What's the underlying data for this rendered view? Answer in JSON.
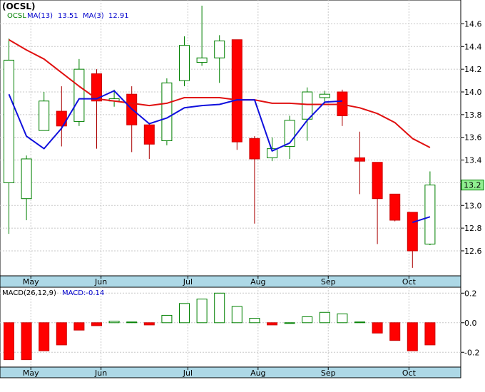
{
  "chart_data": [
    {
      "type": "candlestick",
      "title": "(OCSL)",
      "legend": [
        {
          "label": "OCSL",
          "color": "#008000"
        },
        {
          "label": "MA(13)",
          "color": "#0000cc"
        },
        {
          "label": "13.51",
          "color": "#0000cc"
        },
        {
          "label": "MA(3)",
          "color": "#0000cc"
        },
        {
          "label": "12.91",
          "color": "#0000cc"
        }
      ],
      "ylim": [
        12.38,
        14.81
      ],
      "yticks": [
        12.6,
        12.8,
        13.0,
        13.2,
        13.4,
        13.6,
        13.8,
        14.0,
        14.2,
        14.4,
        14.6
      ],
      "ytick_labels": [
        "12.6",
        "12.8",
        "13.0",
        "13.2",
        "13.4",
        "13.6",
        "13.8",
        "14.0",
        "14.2",
        "14.4",
        "14.6"
      ],
      "months": [
        {
          "label": "May",
          "at": 1.25
        },
        {
          "label": "Jun",
          "at": 5.25
        },
        {
          "label": "Jul",
          "at": 10.2
        },
        {
          "label": "Aug",
          "at": 14.2
        },
        {
          "label": "Sep",
          "at": 18.2
        },
        {
          "label": "Oct",
          "at": 22.8
        }
      ],
      "candles": [
        {
          "o": 13.2,
          "h": 14.47,
          "l": 12.75,
          "c": 14.28
        },
        {
          "o": 13.06,
          "h": 13.44,
          "l": 12.87,
          "c": 13.41
        },
        {
          "o": 13.66,
          "h": 14.0,
          "l": 13.66,
          "c": 13.92
        },
        {
          "o": 13.83,
          "h": 14.05,
          "l": 13.52,
          "c": 13.7
        },
        {
          "o": 13.74,
          "h": 14.29,
          "l": 13.7,
          "c": 14.2
        },
        {
          "o": 14.16,
          "h": 14.2,
          "l": 13.5,
          "c": 13.92
        },
        {
          "o": 13.92,
          "h": 14.02,
          "l": 13.87,
          "c": 13.94
        },
        {
          "o": 13.98,
          "h": 14.05,
          "l": 13.47,
          "c": 13.71
        },
        {
          "o": 13.71,
          "h": 13.73,
          "l": 13.41,
          "c": 13.54
        },
        {
          "o": 13.57,
          "h": 14.12,
          "l": 13.53,
          "c": 14.08
        },
        {
          "o": 14.1,
          "h": 14.49,
          "l": 14.05,
          "c": 14.41
        },
        {
          "o": 14.26,
          "h": 14.76,
          "l": 14.23,
          "c": 14.3
        },
        {
          "o": 14.3,
          "h": 14.5,
          "l": 14.08,
          "c": 14.45
        },
        {
          "o": 14.46,
          "h": 14.46,
          "l": 13.49,
          "c": 13.56
        },
        {
          "o": 13.59,
          "h": 13.61,
          "l": 12.84,
          "c": 13.41
        },
        {
          "o": 13.42,
          "h": 13.6,
          "l": 13.39,
          "c": 13.5
        },
        {
          "o": 13.52,
          "h": 13.79,
          "l": 13.41,
          "c": 13.75
        },
        {
          "o": 13.76,
          "h": 14.04,
          "l": 13.57,
          "c": 14.0
        },
        {
          "o": 13.95,
          "h": 14.01,
          "l": 13.9,
          "c": 13.98
        },
        {
          "o": 14.0,
          "h": 14.02,
          "l": 13.7,
          "c": 13.79
        },
        {
          "o": 13.42,
          "h": 13.65,
          "l": 13.1,
          "c": 13.39
        },
        {
          "o": 13.38,
          "h": 13.38,
          "l": 12.66,
          "c": 13.06
        },
        {
          "o": 13.1,
          "h": 13.1,
          "l": 12.86,
          "c": 12.87
        },
        {
          "o": 12.94,
          "h": 12.94,
          "l": 12.45,
          "c": 12.6
        },
        {
          "o": 12.66,
          "h": 13.3,
          "l": 12.65,
          "c": 13.18
        }
      ],
      "ma_long": {
        "name": "MA(13)",
        "color": "#e01010",
        "points": [
          [
            0,
            14.46
          ],
          [
            1,
            14.37
          ],
          [
            2,
            14.29
          ],
          [
            3,
            14.17
          ],
          [
            4,
            14.05
          ],
          [
            5,
            13.94
          ],
          [
            6,
            13.92
          ],
          [
            7,
            13.9
          ],
          [
            8,
            13.88
          ],
          [
            9,
            13.9
          ],
          [
            10,
            13.95
          ],
          [
            11,
            13.95
          ],
          [
            12,
            13.95
          ],
          [
            13,
            13.93
          ],
          [
            14,
            13.93
          ],
          [
            15,
            13.9
          ],
          [
            16,
            13.9
          ],
          [
            17,
            13.89
          ],
          [
            18,
            13.89
          ],
          [
            19,
            13.89
          ],
          [
            20,
            13.86
          ],
          [
            21,
            13.81
          ],
          [
            22,
            13.73
          ],
          [
            23,
            13.59
          ],
          [
            24,
            13.51
          ]
        ]
      },
      "ma_short": {
        "name": "MA(3)",
        "color": "#1010dd",
        "points": [
          [
            0,
            13.98
          ],
          [
            1,
            13.61
          ],
          [
            2,
            13.5
          ],
          [
            3,
            13.68
          ],
          [
            4,
            13.94
          ],
          [
            5,
            13.94
          ],
          [
            6,
            14.01
          ],
          [
            7,
            13.85
          ],
          [
            8,
            13.72
          ],
          [
            9,
            13.77
          ],
          [
            10,
            13.86
          ],
          [
            11,
            13.88
          ],
          [
            12,
            13.89
          ],
          [
            13,
            13.93
          ],
          [
            14,
            13.93
          ],
          [
            15,
            13.48
          ],
          [
            16,
            13.55
          ],
          [
            17,
            13.75
          ],
          [
            18,
            13.91
          ],
          [
            19,
            13.92
          ],
          [
            20,
            null
          ],
          [
            21,
            null
          ],
          [
            22,
            null
          ],
          [
            23,
            12.85
          ],
          [
            24,
            12.9
          ]
        ]
      },
      "tag": {
        "value": 13.18,
        "label": "13.2"
      }
    },
    {
      "type": "bar",
      "title": "MACD(26,12,9)",
      "legend": [
        {
          "label": "MACD(26,12,9)",
          "color": "#000000"
        },
        {
          "label": "MACD:-0.14",
          "color": "#0000cc"
        }
      ],
      "ylim": [
        -0.3,
        0.24
      ],
      "yticks": [
        -0.2,
        0.0,
        0.2
      ],
      "ytick_labels": [
        "-0.2",
        "0.0",
        "0.2"
      ],
      "values": [
        -0.25,
        -0.25,
        -0.19,
        -0.15,
        -0.05,
        -0.02,
        0.01,
        0.005,
        -0.015,
        0.05,
        0.13,
        0.16,
        0.2,
        0.11,
        0.03,
        -0.015,
        0.0,
        0.04,
        0.07,
        0.06,
        0.005,
        -0.07,
        -0.12,
        -0.19,
        -0.15
      ]
    }
  ]
}
